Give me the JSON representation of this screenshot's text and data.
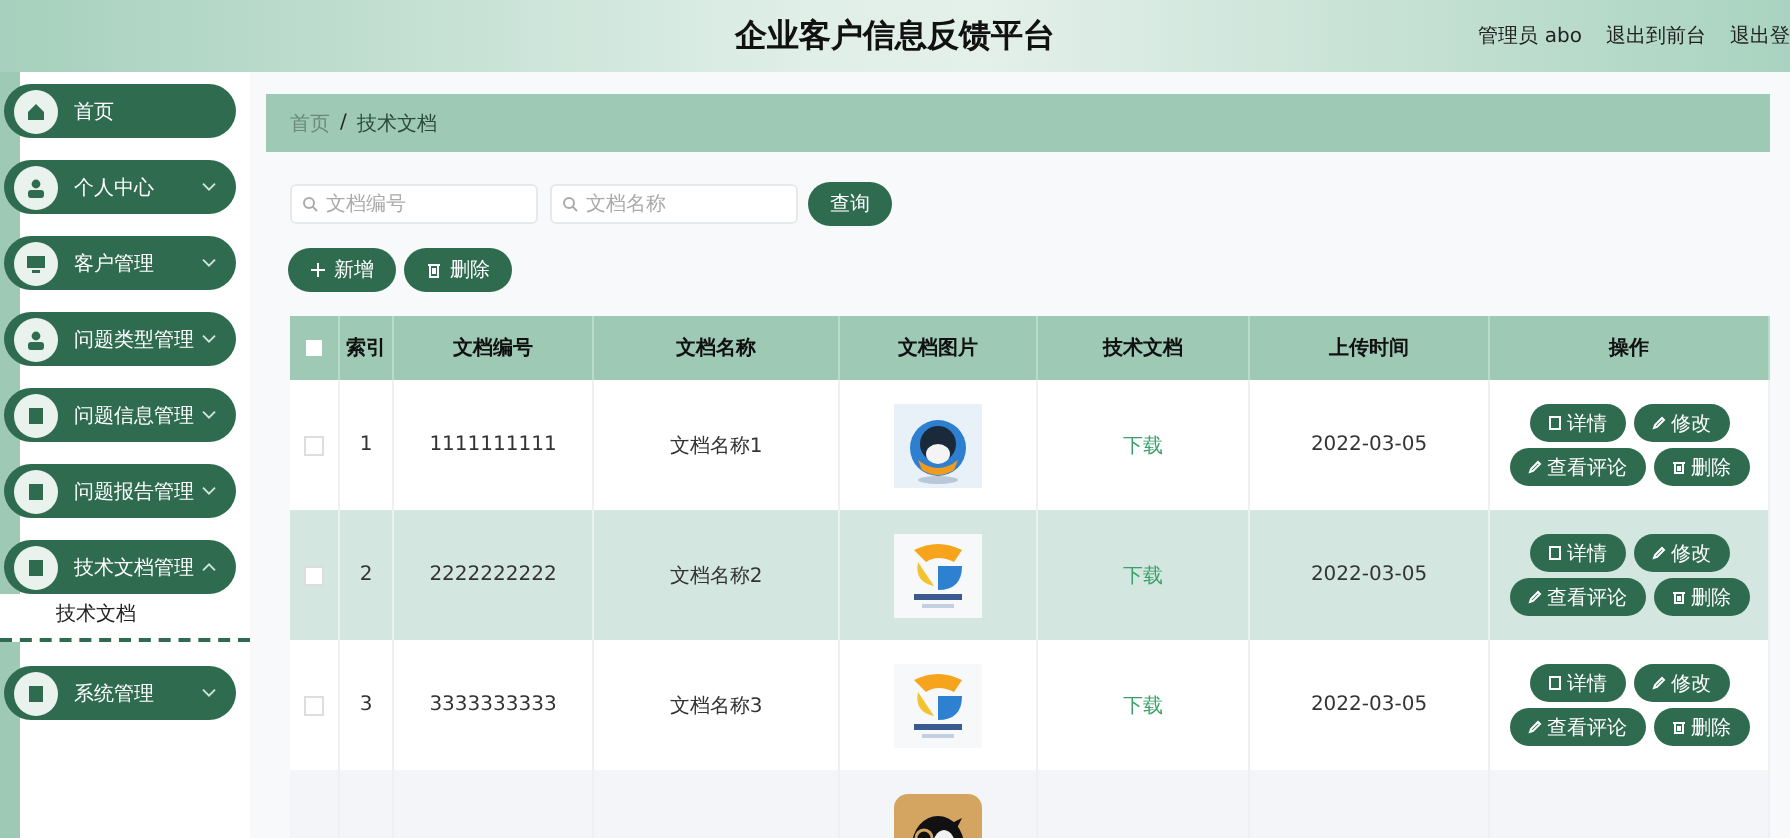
{
  "header": {
    "title": "企业客户信息反馈平台",
    "user": "管理员 abo",
    "links": [
      "退出到前台",
      "退出登"
    ]
  },
  "sidebar": {
    "items": [
      {
        "label": "首页"
      },
      {
        "label": "个人中心",
        "expanded": false
      },
      {
        "label": "客户管理",
        "expanded": false
      },
      {
        "label": "问题类型管理",
        "expanded": false
      },
      {
        "label": "问题信息管理",
        "expanded": false
      },
      {
        "label": "问题报告管理",
        "expanded": false
      },
      {
        "label": "技术文档管理",
        "expanded": true,
        "children": [
          {
            "label": "技术文档",
            "selected": true
          }
        ]
      },
      {
        "label": "系统管理",
        "expanded": false
      }
    ]
  },
  "breadcrumb": {
    "items": [
      "首页",
      "技术文档"
    ],
    "separator": "/"
  },
  "search": {
    "fields": [
      {
        "placeholder": "文档编号"
      },
      {
        "placeholder": "文档名称"
      }
    ],
    "button": "查询"
  },
  "toolbar": [
    "新增",
    "删除"
  ],
  "table": {
    "all_checked": false,
    "columns": [
      "索引",
      "文档编号",
      "文档名称",
      "文档图片",
      "技术文档",
      "上传时间",
      "操作"
    ],
    "rows": [
      {
        "index": "1",
        "code": "1111111111",
        "name": "文档名称1",
        "file": "下载",
        "time": "2022-03-05",
        "actions": [
          "详情",
          "修改",
          "查看评论",
          "删除"
        ],
        "selected": false
      },
      {
        "index": "2",
        "code": "2222222222",
        "name": "文档名称2",
        "file": "下载",
        "time": "2022-03-05",
        "actions": [
          "详情",
          "修改",
          "查看评论",
          "删除"
        ],
        "selected": true
      },
      {
        "index": "3",
        "code": "3333333333",
        "name": "文档名称3",
        "file": "下载",
        "time": "2022-03-05",
        "actions": [
          "详情",
          "修改",
          "查看评论",
          "删除"
        ],
        "selected": false
      },
      {
        "selected": false
      }
    ]
  }
}
